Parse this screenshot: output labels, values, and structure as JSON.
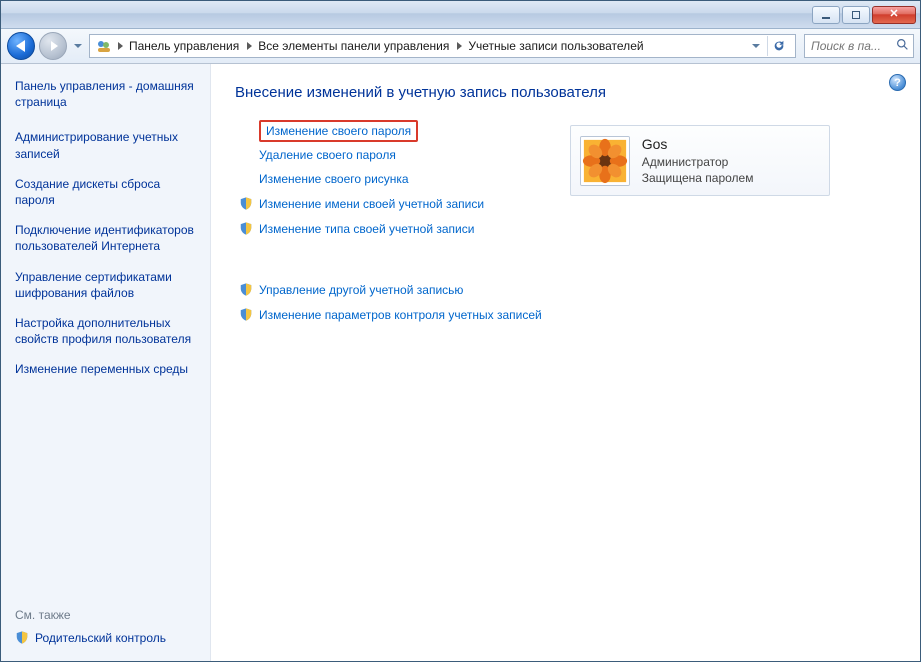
{
  "titlebar": {},
  "breadcrumbs": {
    "items": [
      "Панель управления",
      "Все элементы панели управления",
      "Учетные записи пользователей"
    ]
  },
  "search": {
    "placeholder": "Поиск в па..."
  },
  "sidebar": {
    "home": "Панель управления - домашняя страница",
    "links": [
      "Администрирование учетных записей",
      "Создание дискеты сброса пароля",
      "Подключение идентификаторов пользователей Интернета",
      "Управление сертификатами шифрования файлов",
      "Настройка дополнительных свойств профиля пользователя",
      "Изменение переменных среды"
    ],
    "see_also": "См. также",
    "parental": "Родительский контроль"
  },
  "main": {
    "title": "Внесение изменений в учетную запись пользователя",
    "actions_top": [
      {
        "label": "Изменение своего пароля",
        "shield": false,
        "highlight": true,
        "indent": true
      },
      {
        "label": "Удаление своего пароля",
        "shield": false,
        "highlight": false,
        "indent": true
      },
      {
        "label": "Изменение своего рисунка",
        "shield": false,
        "highlight": false,
        "indent": true
      },
      {
        "label": "Изменение имени своей учетной записи",
        "shield": true,
        "highlight": false,
        "indent": false
      },
      {
        "label": "Изменение типа своей учетной записи",
        "shield": true,
        "highlight": false,
        "indent": false
      }
    ],
    "actions_bottom": [
      {
        "label": "Управление другой учетной записью",
        "shield": true
      },
      {
        "label": "Изменение параметров контроля учетных записей",
        "shield": true
      }
    ],
    "user": {
      "name": "Gos",
      "role": "Администратор",
      "status": "Защищена паролем"
    }
  }
}
